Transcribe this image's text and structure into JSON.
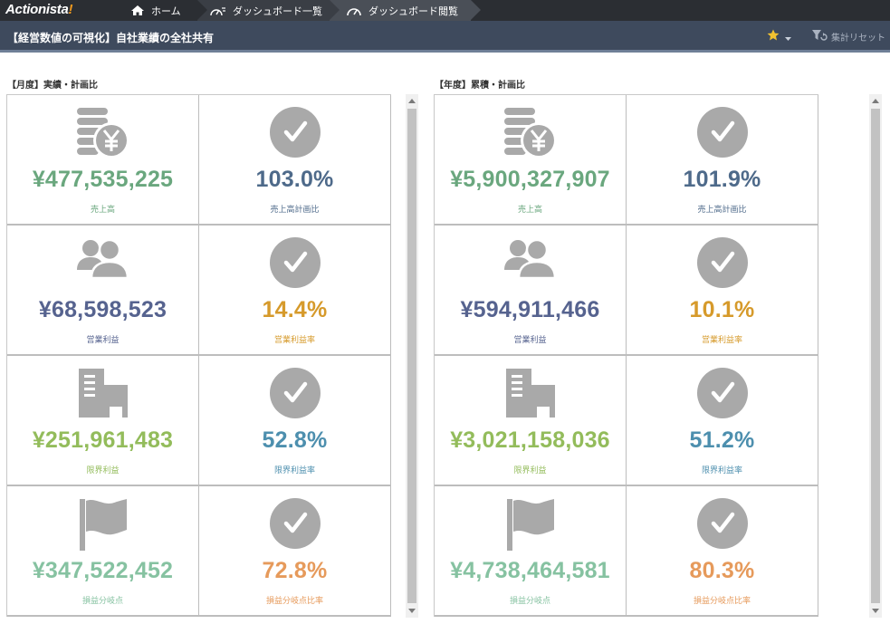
{
  "app": {
    "logo_main": "Actionista",
    "logo_mark": "!"
  },
  "nav": {
    "home": {
      "label": "ホーム",
      "icon": "home-icon"
    },
    "list": {
      "label": "ダッシュボード一覧",
      "icon": "dashboard-list-icon"
    },
    "view": {
      "label": "ダッシュボード閲覧",
      "icon": "gauge-icon"
    }
  },
  "titlebar": {
    "title": "【経営数値の可視化】自社業績の全社共有",
    "favorite_icon": "star-icon",
    "reset_label": "集計リセット",
    "reset_icon": "filter-reset-icon"
  },
  "colors": {
    "green": "#6aa77e",
    "blue": "#4e6a8a",
    "navy": "#56638f",
    "orange_dark": "#d69a2b",
    "lime": "#93bc5b",
    "teal": "#4d8fae",
    "mint": "#86c2a1",
    "orange": "#e69a5b",
    "icon_gray": "#a9a9a9"
  },
  "panels": [
    {
      "label": "【月度】実績・計画比",
      "rows": [
        {
          "left": {
            "icon": "yen-coins-icon",
            "value": "¥477,535,225",
            "label": "売上高",
            "color": "#6aa77e"
          },
          "right": {
            "icon": "check-circle-icon",
            "value": "103.0%",
            "label": "売上高計画比",
            "color": "#4e6a8a"
          }
        },
        {
          "left": {
            "icon": "users-icon",
            "value": "¥68,598,523",
            "label": "営業利益",
            "color": "#56638f"
          },
          "right": {
            "icon": "check-circle-icon",
            "value": "14.4%",
            "label": "営業利益率",
            "color": "#d69a2b"
          }
        },
        {
          "left": {
            "icon": "building-icon",
            "value": "¥251,961,483",
            "label": "限界利益",
            "color": "#93bc5b"
          },
          "right": {
            "icon": "check-circle-icon",
            "value": "52.8%",
            "label": "限界利益率",
            "color": "#4d8fae"
          }
        },
        {
          "left": {
            "icon": "flag-icon",
            "value": "¥347,522,452",
            "label": "損益分岐点",
            "color": "#86c2a1"
          },
          "right": {
            "icon": "check-circle-icon",
            "value": "72.8%",
            "label": "損益分岐点比率",
            "color": "#e69a5b"
          }
        }
      ]
    },
    {
      "label": "【年度】累積・計画比",
      "rows": [
        {
          "left": {
            "icon": "yen-coins-icon",
            "value": "¥5,900,327,907",
            "label": "売上高",
            "color": "#6aa77e"
          },
          "right": {
            "icon": "check-circle-icon",
            "value": "101.9%",
            "label": "売上高計画比",
            "color": "#4e6a8a"
          }
        },
        {
          "left": {
            "icon": "users-icon",
            "value": "¥594,911,466",
            "label": "営業利益",
            "color": "#56638f"
          },
          "right": {
            "icon": "check-circle-icon",
            "value": "10.1%",
            "label": "営業利益率",
            "color": "#d69a2b"
          }
        },
        {
          "left": {
            "icon": "building-icon",
            "value": "¥3,021,158,036",
            "label": "限界利益",
            "color": "#93bc5b"
          },
          "right": {
            "icon": "check-circle-icon",
            "value": "51.2%",
            "label": "限界利益率",
            "color": "#4d8fae"
          }
        },
        {
          "left": {
            "icon": "flag-icon",
            "value": "¥4,738,464,581",
            "label": "損益分岐点",
            "color": "#86c2a1"
          },
          "right": {
            "icon": "check-circle-icon",
            "value": "80.3%",
            "label": "損益分岐点比率",
            "color": "#e69a5b"
          }
        }
      ]
    }
  ]
}
